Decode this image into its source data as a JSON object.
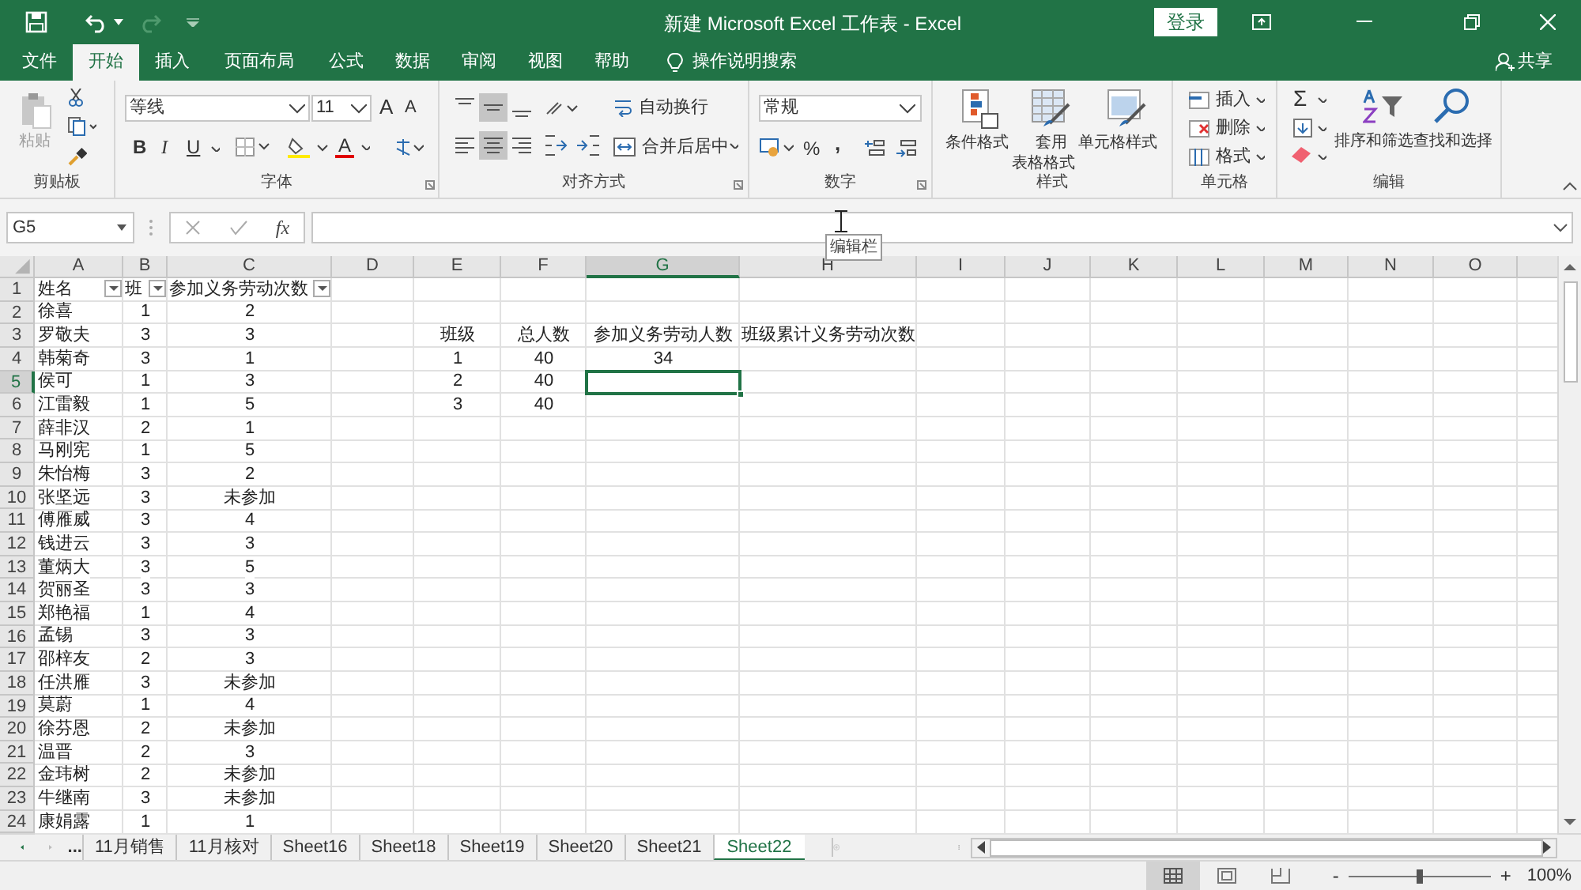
{
  "window": {
    "title": "新建 Microsoft Excel 工作表 - Excel",
    "sign_in": "登录",
    "redo_disabled": true
  },
  "menu_tabs": [
    {
      "label": "文件",
      "selected": false
    },
    {
      "label": "开始",
      "selected": true
    },
    {
      "label": "插入",
      "selected": false
    },
    {
      "label": "页面布局",
      "selected": false
    },
    {
      "label": "公式",
      "selected": false
    },
    {
      "label": "数据",
      "selected": false
    },
    {
      "label": "审阅",
      "selected": false
    },
    {
      "label": "视图",
      "selected": false
    },
    {
      "label": "帮助",
      "selected": false
    }
  ],
  "tell_me": "操作说明搜索",
  "share": "共享",
  "ribbon": {
    "clipboard": {
      "group": "剪贴板",
      "paste": "粘贴",
      "paste_disabled": true
    },
    "font": {
      "group": "字体",
      "name": "等线",
      "size": "11",
      "grow": "A",
      "shrink": "A",
      "bold": "B",
      "italic": "I",
      "underline": "U",
      "font_color": "A"
    },
    "alignment": {
      "group": "对齐方式",
      "wrap_text": "自动换行",
      "merge_center": "合并后居中",
      "buttons": [
        {
          "kind": "top",
          "selected": false
        },
        {
          "kind": "middle",
          "selected": true
        },
        {
          "kind": "bottom",
          "selected": false
        },
        {
          "kind": "left",
          "selected": false
        },
        {
          "kind": "center",
          "selected": true
        },
        {
          "kind": "right",
          "selected": false
        }
      ]
    },
    "number": {
      "group": "数字",
      "format": "常规",
      "percent": "%",
      "comma": ","
    },
    "styles": {
      "group": "样式",
      "conditional": "条件格式",
      "table_format_1": "套用",
      "table_format_2": "表格格式",
      "cell_styles": "单元格样式"
    },
    "cells": {
      "group": "单元格",
      "items": [
        "插入",
        "删除",
        "格式"
      ]
    },
    "editing": {
      "group": "编辑",
      "sum": "Σ",
      "sort_filter": "排序和筛选",
      "find_select": "查找和选择"
    }
  },
  "formula_bar": {
    "name_box": "G5",
    "fx": "fx",
    "tooltip": "编辑栏"
  },
  "grid": {
    "filter_buttons": true,
    "columns": [
      {
        "label": "A",
        "selected": false
      },
      {
        "label": "B",
        "selected": false
      },
      {
        "label": "C",
        "selected": false
      },
      {
        "label": "D",
        "selected": false
      },
      {
        "label": "E",
        "selected": false
      },
      {
        "label": "F",
        "selected": false
      },
      {
        "label": "G",
        "selected": true
      },
      {
        "label": "H",
        "selected": false
      },
      {
        "label": "I",
        "selected": false
      },
      {
        "label": "J",
        "selected": false
      },
      {
        "label": "K",
        "selected": false
      },
      {
        "label": "L",
        "selected": false
      },
      {
        "label": "M",
        "selected": false
      },
      {
        "label": "N",
        "selected": false
      },
      {
        "label": "O",
        "selected": false
      }
    ],
    "rows": [
      {
        "number": "1",
        "selected": false,
        "A": "姓名",
        "B": "班",
        "C": "参加义务劳动次数"
      },
      {
        "number": "2",
        "selected": false,
        "A": "徐喜",
        "B": "1",
        "C": "2"
      },
      {
        "number": "3",
        "selected": false,
        "A": "罗敬夫",
        "B": "3",
        "C": "3",
        "E": "班级",
        "F": "总人数",
        "G": "参加义务劳动人数",
        "H": "班级累计义务劳动次数"
      },
      {
        "number": "4",
        "selected": false,
        "A": "韩菊奇",
        "B": "3",
        "C": "1",
        "E": "1",
        "F": "40",
        "G": "34"
      },
      {
        "number": "5",
        "selected": true,
        "A": "侯可",
        "B": "1",
        "C": "3",
        "E": "2",
        "F": "40"
      },
      {
        "number": "6",
        "selected": false,
        "A": "江雷毅",
        "B": "1",
        "C": "5",
        "E": "3",
        "F": "40"
      },
      {
        "number": "7",
        "selected": false,
        "A": "薛非汉",
        "B": "2",
        "C": "1"
      },
      {
        "number": "8",
        "selected": false,
        "A": "马刚宪",
        "B": "1",
        "C": "5"
      },
      {
        "number": "9",
        "selected": false,
        "A": "朱怡梅",
        "B": "3",
        "C": "2"
      },
      {
        "number": "10",
        "selected": false,
        "A": "张坚远",
        "B": "3",
        "C": "未参加"
      },
      {
        "number": "11",
        "selected": false,
        "A": "傅雁威",
        "B": "3",
        "C": "4"
      },
      {
        "number": "12",
        "selected": false,
        "A": "钱进云",
        "B": "3",
        "C": "3"
      },
      {
        "number": "13",
        "selected": false,
        "A": "董炳大",
        "B": "3",
        "C": "5"
      },
      {
        "number": "14",
        "selected": false,
        "A": "贺丽圣",
        "B": "3",
        "C": "3"
      },
      {
        "number": "15",
        "selected": false,
        "A": "郑艳福",
        "B": "1",
        "C": "4"
      },
      {
        "number": "16",
        "selected": false,
        "A": "孟锡",
        "B": "3",
        "C": "3"
      },
      {
        "number": "17",
        "selected": false,
        "A": "邵梓友",
        "B": "2",
        "C": "3"
      },
      {
        "number": "18",
        "selected": false,
        "A": "任洪雁",
        "B": "3",
        "C": "未参加"
      },
      {
        "number": "19",
        "selected": false,
        "A": "莫蔚",
        "B": "1",
        "C": "4"
      },
      {
        "number": "20",
        "selected": false,
        "A": "徐芬恩",
        "B": "2",
        "C": "未参加"
      },
      {
        "number": "21",
        "selected": false,
        "A": "温晋",
        "B": "2",
        "C": "3"
      },
      {
        "number": "22",
        "selected": false,
        "A": "金玮树",
        "B": "2",
        "C": "未参加"
      },
      {
        "number": "23",
        "selected": false,
        "A": "牛继南",
        "B": "3",
        "C": "未参加"
      },
      {
        "number": "24",
        "selected": false,
        "A": "康娟露",
        "B": "1",
        "C": "1"
      }
    ]
  },
  "sheet_tabs": {
    "more": "...",
    "tabs": [
      {
        "label": "11月销售",
        "selected": false
      },
      {
        "label": "11月核对",
        "selected": false
      },
      {
        "label": "Sheet16",
        "selected": false
      },
      {
        "label": "Sheet18",
        "selected": false
      },
      {
        "label": "Sheet19",
        "selected": false
      },
      {
        "label": "Sheet20",
        "selected": false
      },
      {
        "label": "Sheet21",
        "selected": false
      },
      {
        "label": "Sheet22",
        "selected": true
      }
    ]
  },
  "status_bar": {
    "views": [
      {
        "kind": "normal",
        "selected": true
      },
      {
        "kind": "page_layout",
        "selected": false
      },
      {
        "kind": "page_break",
        "selected": false
      }
    ],
    "zoom_out": "-",
    "zoom_in": "+",
    "zoom": {
      "level": 0.5
    },
    "zoom_label": "100%"
  }
}
